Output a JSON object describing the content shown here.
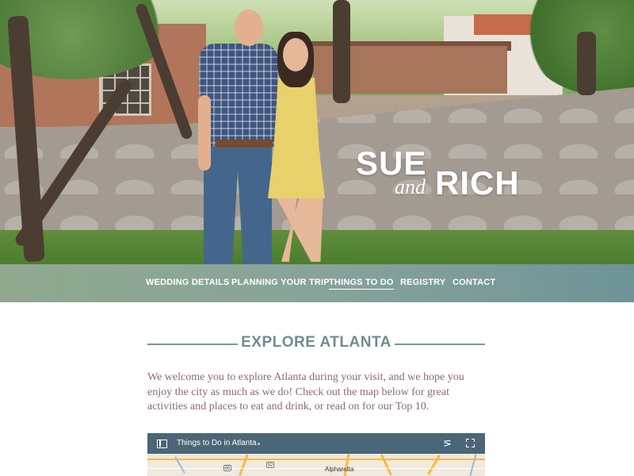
{
  "hero": {
    "title_first": "SUE",
    "title_and": "and",
    "title_second": "RICH"
  },
  "nav": {
    "items": [
      {
        "label": "WEDDING DETAILS",
        "active": false
      },
      {
        "label": "PLANNING YOUR TRIP",
        "active": false
      },
      {
        "label": "THINGS TO DO",
        "active": true
      },
      {
        "label": "REGISTRY",
        "active": false
      },
      {
        "label": "CONTACT",
        "active": false
      }
    ]
  },
  "section": {
    "heading": "EXPLORE ATLANTA",
    "intro": "We welcome you to explore Atlanta during your visit, and we hope you enjoy the city as much as we do! Check out the map below for great activities and places to eat and drink, or read on for our Top 10."
  },
  "map": {
    "title": "Things to Do in Atlanta",
    "place_label": "Alpharetta",
    "route_shield_1": "92",
    "route_shield_2": "85",
    "icons": [
      "list-icon",
      "share-icon",
      "fullscreen-icon"
    ]
  },
  "colors": {
    "accent_heading": "#6d8d90",
    "intro_text": "#8a6a78",
    "map_bar": "#4a6677"
  }
}
